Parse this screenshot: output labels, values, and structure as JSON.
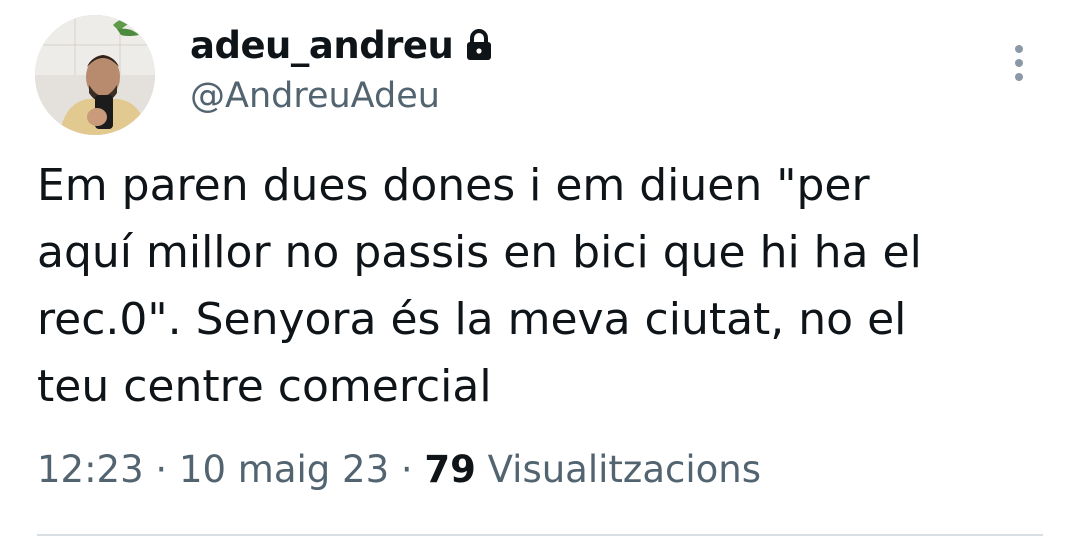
{
  "tweet": {
    "author": {
      "display_name": "adeu_andreu",
      "handle": "@AndreuAdeu",
      "protected_icon": "lock-icon"
    },
    "text_lines": [
      "Em paren dues dones i em diuen \"per",
      "aquí millor no passis en bici que hi ha el",
      "rec.0\". Senyora és la meva ciutat, no el",
      "teu centre comercial"
    ],
    "time": "12:23",
    "separator": "·",
    "date": "10 maig 23",
    "views_count": "79",
    "views_label": "Visualitzacions",
    "menu_icon": "more-vertical-icon"
  },
  "colors": {
    "text_primary": "#0f1419",
    "text_secondary": "#536471",
    "divider": "#d9dee2"
  }
}
